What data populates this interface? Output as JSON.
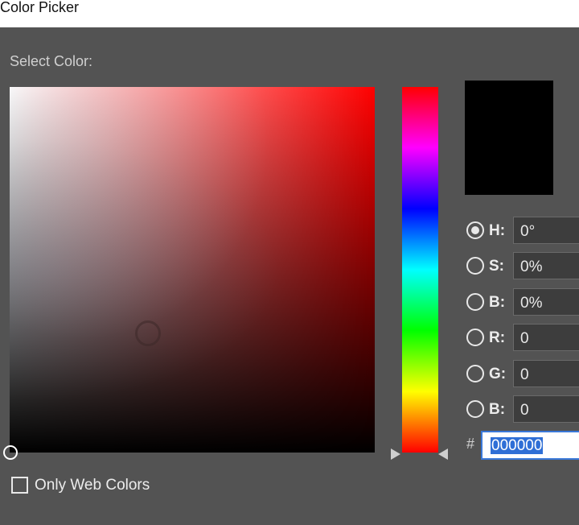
{
  "window": {
    "title": "Color Picker"
  },
  "picker": {
    "select_label": "Select Color:",
    "preview_color": "#000000"
  },
  "fields": [
    {
      "key": "H",
      "label": "H:",
      "value": "0°",
      "checked": true
    },
    {
      "key": "S",
      "label": "S:",
      "value": "0%",
      "checked": false
    },
    {
      "key": "Bri",
      "label": "B:",
      "value": "0%",
      "checked": false
    },
    {
      "key": "R",
      "label": "R:",
      "value": "0",
      "checked": false
    },
    {
      "key": "G",
      "label": "G:",
      "value": "0",
      "checked": false
    },
    {
      "key": "Blue",
      "label": "B:",
      "value": "0",
      "checked": false
    }
  ],
  "hex": {
    "prefix": "#",
    "value": "000000"
  },
  "web_colors": {
    "label": "Only Web Colors",
    "checked": false
  },
  "colors": {
    "accent": "#3a78d8",
    "hue": "#ff0000"
  },
  "icons": {
    "hue_slider_left": "triangle-right-icon",
    "hue_slider_right": "triangle-left-icon"
  }
}
